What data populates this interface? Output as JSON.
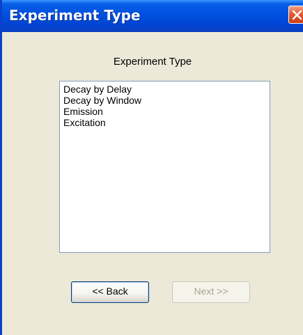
{
  "window": {
    "title": "Experiment Type"
  },
  "main": {
    "heading": "Experiment Type",
    "list_items": [
      "Decay by Delay",
      "Decay by Window",
      "Emission",
      "Excitation"
    ]
  },
  "buttons": {
    "back_label": "<< Back",
    "next_label": "Next >>",
    "next_enabled": false
  },
  "colors": {
    "titlebar": "#0052e0",
    "dialog_bg": "#ece9d8",
    "close_button": "#e5592f"
  },
  "icons": {
    "close": "close-icon"
  }
}
